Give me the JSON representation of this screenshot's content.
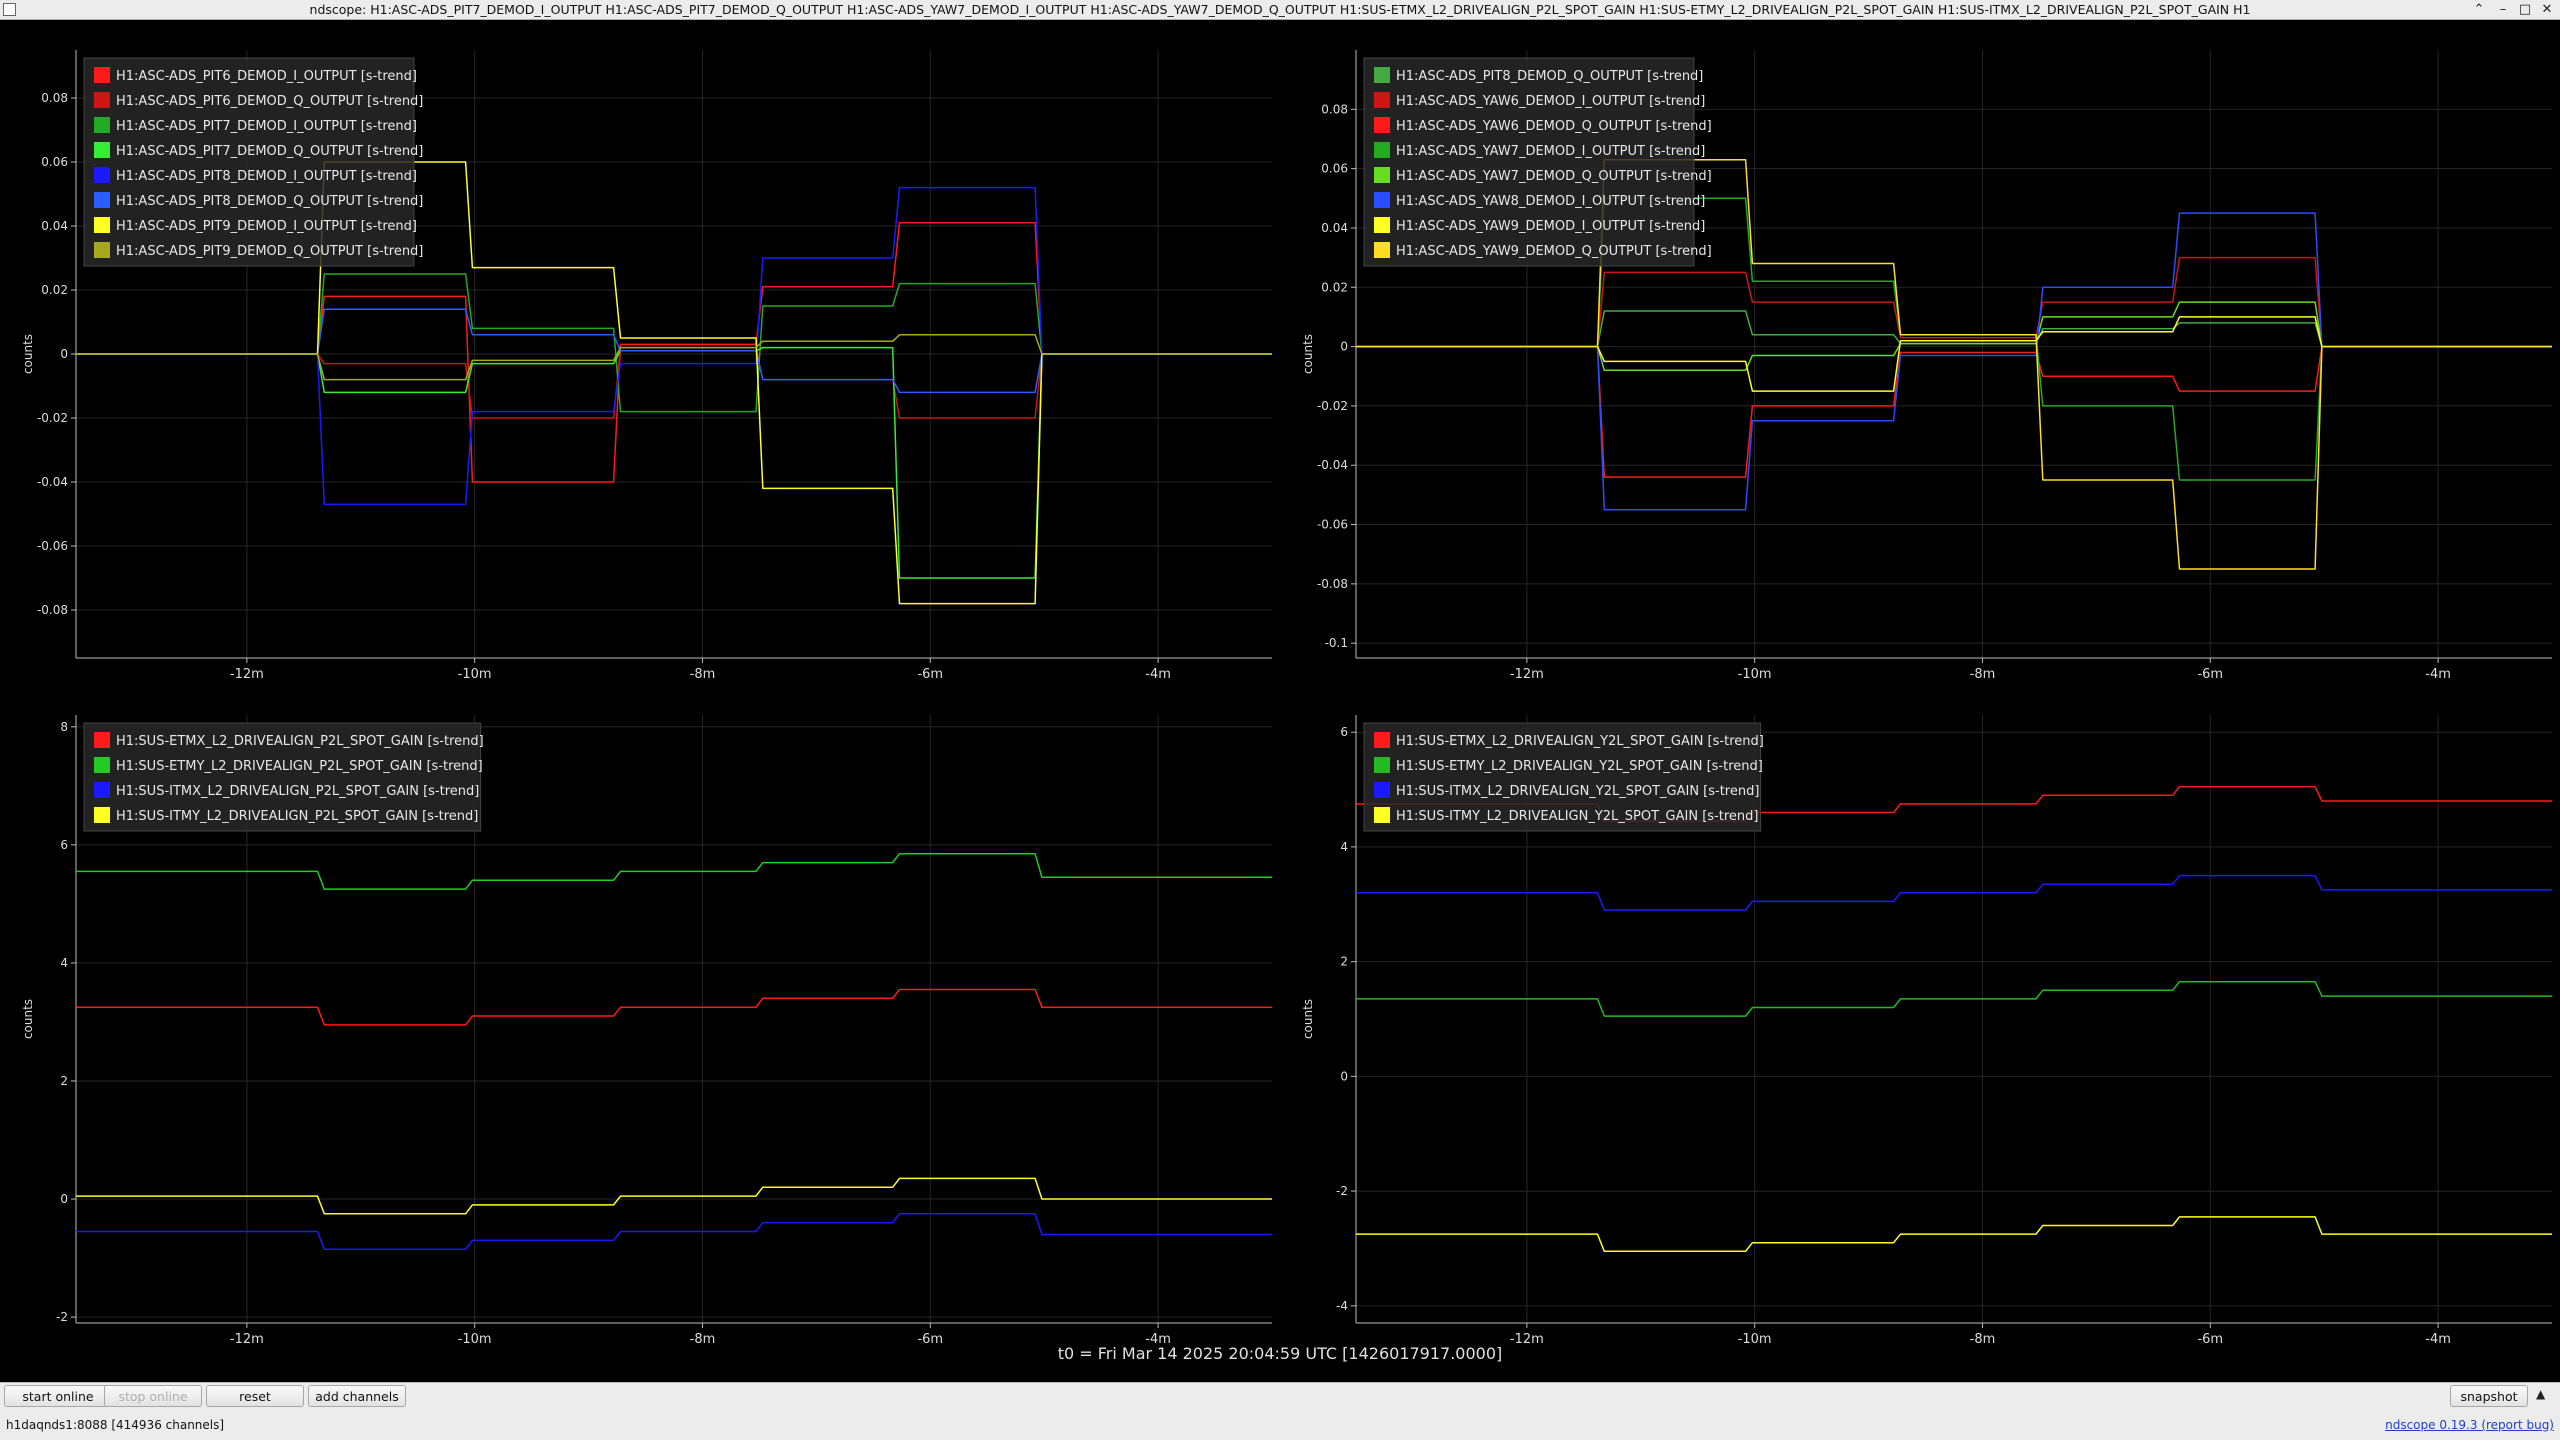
{
  "window": {
    "title": "ndscope: H1:ASC-ADS_PIT7_DEMOD_I_OUTPUT H1:ASC-ADS_PIT7_DEMOD_Q_OUTPUT H1:ASC-ADS_YAW7_DEMOD_I_OUTPUT H1:ASC-ADS_YAW7_DEMOD_Q_OUTPUT H1:SUS-ETMX_L2_DRIVEALIGN_P2L_SPOT_GAIN H1:SUS-ETMY_L2_DRIVEALIGN_P2L_SPOT_GAIN H1:SUS-ITMX_L2_DRIVEALIGN_P2L_SPOT_GAIN H1",
    "controls": {
      "shade": "⌃",
      "minimize": "–",
      "maximize": "□",
      "close": "✕"
    }
  },
  "t0_label": "t0 = Fri Mar 14 2025 20:04:59 UTC [1426017917.0000]",
  "toolbar": {
    "start_online": "start online",
    "stop_online": "stop online",
    "reset": "reset",
    "add_channels": "add channels",
    "snapshot": "snapshot",
    "menu_icon": "triangle-up-icon"
  },
  "status": {
    "server": "h1daqnds1:8088  [414936 channels]",
    "version": "ndscope 0.19.3 (report bug)"
  },
  "chart_data": [
    {
      "type": "line",
      "ylabel": "counts",
      "xlim": [
        -13.5,
        -3
      ],
      "ylim": [
        -0.095,
        0.095
      ],
      "xticks": [
        {
          "v": -12,
          "label": "-12m"
        },
        {
          "v": -10,
          "label": "-10m"
        },
        {
          "v": -8,
          "label": "-8m"
        },
        {
          "v": -6,
          "label": "-6m"
        },
        {
          "v": -4,
          "label": "-4m"
        }
      ],
      "yticks": [
        {
          "v": -0.08,
          "label": "-0.08"
        },
        {
          "v": -0.06,
          "label": "-0.06"
        },
        {
          "v": -0.04,
          "label": "-0.04"
        },
        {
          "v": -0.02,
          "label": "-0.02"
        },
        {
          "v": 0,
          "label": "0"
        },
        {
          "v": 0.02,
          "label": "0.02"
        },
        {
          "v": 0.04,
          "label": "0.04"
        },
        {
          "v": 0.06,
          "label": "0.06"
        },
        {
          "v": 0.08,
          "label": "0.08"
        }
      ],
      "grid": true,
      "legend_position": "top-left",
      "breaks": [
        -13.5,
        -11.35,
        -10.05,
        -8.75,
        -7.5,
        -6.3,
        -5.05,
        -3
      ],
      "series": [
        {
          "name": "H1:ASC-ADS_PIT6_DEMOD_I_OUTPUT [s-trend]",
          "color": "#ff1a1a",
          "values": [
            0,
            0.018,
            -0.04,
            0.003,
            0.021,
            0.041,
            0
          ]
        },
        {
          "name": "H1:ASC-ADS_PIT6_DEMOD_Q_OUTPUT [s-trend]",
          "color": "#cc1515",
          "values": [
            0,
            -0.003,
            -0.02,
            0.002,
            -0.008,
            -0.02,
            0
          ]
        },
        {
          "name": "H1:ASC-ADS_PIT7_DEMOD_I_OUTPUT [s-trend]",
          "color": "#22aa22",
          "values": [
            0,
            0.025,
            0.008,
            -0.018,
            0.015,
            0.022,
            0
          ]
        },
        {
          "name": "H1:ASC-ADS_PIT7_DEMOD_Q_OUTPUT [s-trend]",
          "color": "#33ee33",
          "values": [
            0,
            -0.012,
            -0.003,
            0.001,
            0.002,
            -0.07,
            0
          ]
        },
        {
          "name": "H1:ASC-ADS_PIT8_DEMOD_I_OUTPUT [s-trend]",
          "color": "#1a1aff",
          "values": [
            0,
            -0.047,
            -0.018,
            -0.003,
            0.03,
            0.052,
            0
          ]
        },
        {
          "name": "H1:ASC-ADS_PIT8_DEMOD_Q_OUTPUT [s-trend]",
          "color": "#2a5cff",
          "values": [
            0,
            0.014,
            0.006,
            0.001,
            -0.008,
            -0.012,
            0
          ]
        },
        {
          "name": "H1:ASC-ADS_PIT9_DEMOD_I_OUTPUT [s-trend]",
          "color": "#ffff22",
          "values": [
            0,
            0.06,
            0.027,
            0.005,
            -0.042,
            -0.078,
            0
          ]
        },
        {
          "name": "H1:ASC-ADS_PIT9_DEMOD_Q_OUTPUT [s-trend]",
          "color": "#a8a820",
          "values": [
            0,
            -0.008,
            -0.002,
            0.002,
            0.004,
            0.006,
            0
          ]
        }
      ]
    },
    {
      "type": "line",
      "ylabel": "counts",
      "xlim": [
        -13.5,
        -3
      ],
      "ylim": [
        -0.105,
        0.1
      ],
      "xticks": [
        {
          "v": -12,
          "label": "-12m"
        },
        {
          "v": -10,
          "label": "-10m"
        },
        {
          "v": -8,
          "label": "-8m"
        },
        {
          "v": -6,
          "label": "-6m"
        },
        {
          "v": -4,
          "label": "-4m"
        }
      ],
      "yticks": [
        {
          "v": -0.1,
          "label": "-0.1"
        },
        {
          "v": -0.08,
          "label": "-0.08"
        },
        {
          "v": -0.06,
          "label": "-0.06"
        },
        {
          "v": -0.04,
          "label": "-0.04"
        },
        {
          "v": -0.02,
          "label": "-0.02"
        },
        {
          "v": 0,
          "label": "0"
        },
        {
          "v": 0.02,
          "label": "0.02"
        },
        {
          "v": 0.04,
          "label": "0.04"
        },
        {
          "v": 0.06,
          "label": "0.06"
        },
        {
          "v": 0.08,
          "label": "0.08"
        }
      ],
      "grid": true,
      "legend_position": "top-left",
      "breaks": [
        -13.5,
        -11.35,
        -10.05,
        -8.75,
        -7.5,
        -6.3,
        -5.05,
        -3
      ],
      "series": [
        {
          "name": "H1:ASC-ADS_PIT8_DEMOD_Q_OUTPUT [s-trend]",
          "color": "#44aa44",
          "values": [
            0,
            0.012,
            0.004,
            0.001,
            0.006,
            0.008,
            0
          ]
        },
        {
          "name": "H1:ASC-ADS_YAW6_DEMOD_I_OUTPUT [s-trend]",
          "color": "#cc1515",
          "values": [
            0,
            0.025,
            0.015,
            0.003,
            0.015,
            0.03,
            0
          ]
        },
        {
          "name": "H1:ASC-ADS_YAW6_DEMOD_Q_OUTPUT [s-trend]",
          "color": "#ff1a1a",
          "values": [
            0,
            -0.044,
            -0.02,
            -0.002,
            -0.01,
            -0.015,
            0
          ]
        },
        {
          "name": "H1:ASC-ADS_YAW7_DEMOD_I_OUTPUT [s-trend]",
          "color": "#22aa22",
          "values": [
            0,
            0.05,
            0.022,
            0.004,
            -0.02,
            -0.045,
            0
          ]
        },
        {
          "name": "H1:ASC-ADS_YAW7_DEMOD_Q_OUTPUT [s-trend]",
          "color": "#66dd22",
          "values": [
            0,
            -0.008,
            -0.003,
            0.001,
            0.01,
            0.015,
            0
          ]
        },
        {
          "name": "H1:ASC-ADS_YAW8_DEMOD_I_OUTPUT [s-trend]",
          "color": "#2a4cff",
          "values": [
            0,
            -0.055,
            -0.025,
            -0.003,
            0.02,
            0.045,
            0
          ]
        },
        {
          "name": "H1:ASC-ADS_YAW9_DEMOD_I_OUTPUT [s-trend]",
          "color": "#ffff22",
          "values": [
            0,
            -0.005,
            -0.015,
            0.002,
            0.005,
            0.01,
            0
          ]
        },
        {
          "name": "H1:ASC-ADS_YAW9_DEMOD_Q_OUTPUT [s-trend]",
          "color": "#ffdd22",
          "values": [
            0,
            0.063,
            0.028,
            0.004,
            -0.045,
            -0.075,
            0
          ]
        }
      ]
    },
    {
      "type": "line",
      "ylabel": "counts",
      "xlim": [
        -13.5,
        -3
      ],
      "ylim": [
        -2.1,
        8.2
      ],
      "xticks": [
        {
          "v": -12,
          "label": "-12m"
        },
        {
          "v": -10,
          "label": "-10m"
        },
        {
          "v": -8,
          "label": "-8m"
        },
        {
          "v": -6,
          "label": "-6m"
        },
        {
          "v": -4,
          "label": "-4m"
        }
      ],
      "yticks": [
        {
          "v": -2,
          "label": "-2"
        },
        {
          "v": 0,
          "label": "0"
        },
        {
          "v": 2,
          "label": "2"
        },
        {
          "v": 4,
          "label": "4"
        },
        {
          "v": 6,
          "label": "6"
        },
        {
          "v": 8,
          "label": "8"
        }
      ],
      "grid": true,
      "legend_position": "top-left",
      "breaks": [
        -13.5,
        -11.35,
        -10.05,
        -8.75,
        -7.5,
        -6.3,
        -5.05,
        -3
      ],
      "series": [
        {
          "name": "H1:SUS-ETMX_L2_DRIVEALIGN_P2L_SPOT_GAIN [s-trend]",
          "color": "#ff1a1a",
          "values": [
            3.25,
            2.95,
            3.1,
            3.25,
            3.4,
            3.55,
            3.25
          ]
        },
        {
          "name": "H1:SUS-ETMY_L2_DRIVEALIGN_P2L_SPOT_GAIN [s-trend]",
          "color": "#22cc22",
          "values": [
            5.55,
            5.25,
            5.4,
            5.55,
            5.7,
            5.85,
            5.45
          ]
        },
        {
          "name": "H1:SUS-ITMX_L2_DRIVEALIGN_P2L_SPOT_GAIN [s-trend]",
          "color": "#1a1aff",
          "values": [
            -0.55,
            -0.85,
            -0.7,
            -0.55,
            -0.4,
            -0.25,
            -0.6
          ]
        },
        {
          "name": "H1:SUS-ITMY_L2_DRIVEALIGN_P2L_SPOT_GAIN [s-trend]",
          "color": "#ffff22",
          "values": [
            0.05,
            -0.25,
            -0.1,
            0.05,
            0.2,
            0.35,
            0.0
          ]
        }
      ]
    },
    {
      "type": "line",
      "ylabel": "counts",
      "xlim": [
        -13.5,
        -3
      ],
      "ylim": [
        -4.3,
        6.3
      ],
      "xticks": [
        {
          "v": -12,
          "label": "-12m"
        },
        {
          "v": -10,
          "label": "-10m"
        },
        {
          "v": -8,
          "label": "-8m"
        },
        {
          "v": -6,
          "label": "-6m"
        },
        {
          "v": -4,
          "label": "-4m"
        }
      ],
      "yticks": [
        {
          "v": -4,
          "label": "-4"
        },
        {
          "v": -2,
          "label": "-2"
        },
        {
          "v": 0,
          "label": "0"
        },
        {
          "v": 2,
          "label": "2"
        },
        {
          "v": 4,
          "label": "4"
        },
        {
          "v": 6,
          "label": "6"
        }
      ],
      "grid": true,
      "legend_position": "top-left",
      "breaks": [
        -13.5,
        -11.35,
        -10.05,
        -8.75,
        -7.5,
        -6.3,
        -5.05,
        -3
      ],
      "series": [
        {
          "name": "H1:SUS-ETMX_L2_DRIVEALIGN_Y2L_SPOT_GAIN [s-trend]",
          "color": "#ff1a1a",
          "values": [
            4.75,
            4.45,
            4.6,
            4.75,
            4.9,
            5.05,
            4.8
          ]
        },
        {
          "name": "H1:SUS-ETMY_L2_DRIVEALIGN_Y2L_SPOT_GAIN [s-trend]",
          "color": "#22bb22",
          "values": [
            1.35,
            1.05,
            1.2,
            1.35,
            1.5,
            1.65,
            1.4
          ]
        },
        {
          "name": "H1:SUS-ITMX_L2_DRIVEALIGN_Y2L_SPOT_GAIN [s-trend]",
          "color": "#1a1aff",
          "values": [
            3.2,
            2.9,
            3.05,
            3.2,
            3.35,
            3.5,
            3.25
          ]
        },
        {
          "name": "H1:SUS-ITMY_L2_DRIVEALIGN_Y2L_SPOT_GAIN [s-trend]",
          "color": "#ffff22",
          "values": [
            -2.75,
            -3.05,
            -2.9,
            -2.75,
            -2.6,
            -2.45,
            -2.75
          ]
        }
      ]
    }
  ]
}
